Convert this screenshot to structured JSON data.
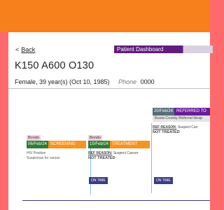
{
  "header": {
    "back_label": "Back",
    "dashboard_title": "Patient Dashboard"
  },
  "patient": {
    "id": "K150 A600 O130",
    "info": "Female,   39 year(s) (Oct 10, 1985)",
    "phone_label": "Phone",
    "phone_value": "0000"
  },
  "timeline": [
    {
      "location": "Bondo",
      "date": "06/Feb/24",
      "status": "SCREENING",
      "lines": [
        "HIV Positive",
        "Suspicious for cancer"
      ]
    },
    {
      "location": "Bondo",
      "date": "15/Feb/24",
      "status": "TREATMENT",
      "ref_label": "REF REASON:",
      "ref_text": "Suspect Cancer",
      "outcome": "NOT TREATED",
      "badge": "ON TIME"
    },
    {
      "date": "20/Feb/24",
      "status": "REFERRED TO",
      "hospital": "Busia County Referral Hosp",
      "ref_label": "REF REASON:",
      "ref_text": "Suspect Can",
      "outcome": "NOT TREATED",
      "badge": "ON TIME"
    }
  ],
  "colors": {
    "accent_orange": "#f7801d",
    "side_red": "#fe6a6c",
    "purple": "#5f1d7e",
    "green": "#2e7d32",
    "navy": "#3a3a86"
  }
}
